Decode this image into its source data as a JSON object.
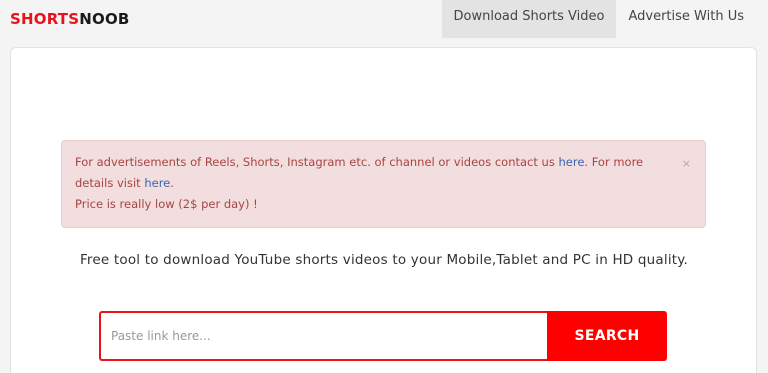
{
  "brand": {
    "part1": "SHORTS",
    "part2": "NOOB"
  },
  "nav": [
    {
      "label": "Download Shorts Video",
      "active": true
    },
    {
      "label": "Advertise With Us",
      "active": false
    }
  ],
  "alert": {
    "line1_text": "For advertisements of Reels, Shorts, Instagram etc. of channel or videos contact us ",
    "line1_link": "here",
    "line1_after": ". For more details visit ",
    "line2_link": "here",
    "line2_after": ".",
    "line3": "Price is really low (2$ per day) !",
    "close_icon": "×"
  },
  "tagline": "Free tool to download YouTube shorts videos to your Mobile,Tablet and PC in HD quality.",
  "search": {
    "placeholder": "Paste link here...",
    "value": "",
    "button_label": "SEARCH"
  },
  "colors": {
    "brand_red": "#e8121b",
    "button_red": "#ff0000",
    "alert_bg": "#f2dede",
    "alert_text": "#a94442",
    "link": "#3b63b3"
  }
}
